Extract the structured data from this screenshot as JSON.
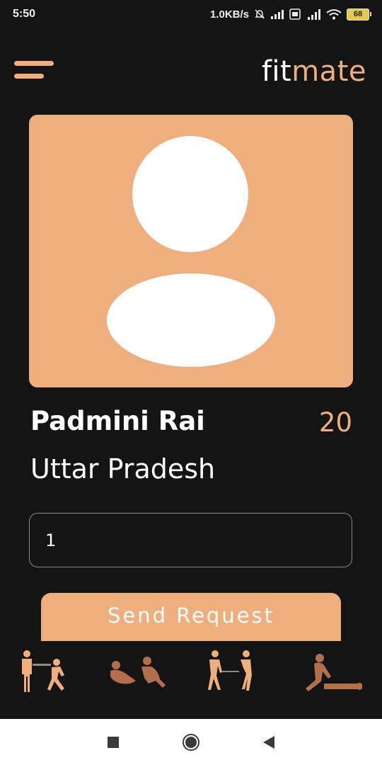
{
  "status_bar": {
    "time": "5:50",
    "network_speed": "1.0KB/s",
    "battery": "68"
  },
  "app": {
    "logo_part1": "fit",
    "logo_part2": "mate",
    "accent_color": "#efaf7d",
    "background_color": "#141414"
  },
  "profile": {
    "name": "Padmini Rai",
    "age": "20",
    "location": "Uttar Pradesh"
  },
  "request": {
    "input_value": "1",
    "button_label": "Send Request"
  },
  "exercise_icons": [
    "partner-carry-icon",
    "partner-situp-icon",
    "partner-stretch-icon",
    "partner-massage-icon"
  ],
  "nav_bar": [
    "recents-square-icon",
    "home-circle-icon",
    "back-triangle-icon"
  ]
}
